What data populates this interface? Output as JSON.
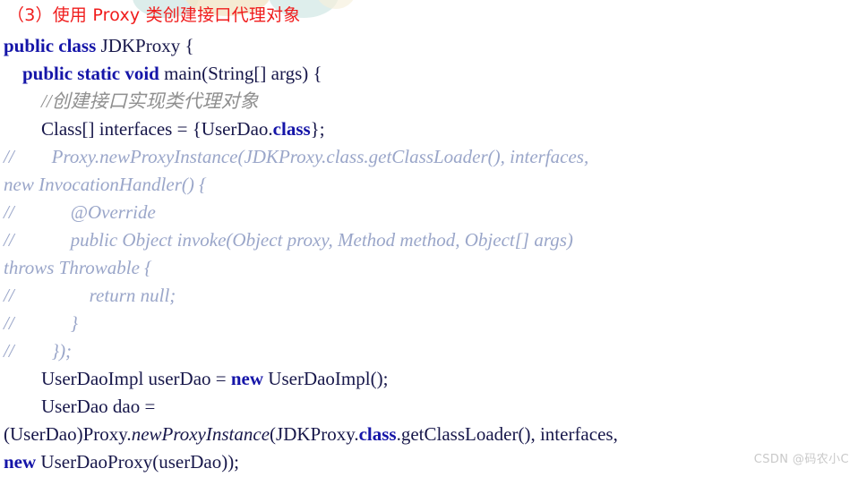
{
  "page": {
    "background_color": "#ffffff",
    "watermark": "CSDN @码农小C"
  },
  "decor": {
    "teal_color": "#cfe6e3",
    "cream_color": "#f3e6c8"
  },
  "title": {
    "text": "（3）使用 Proxy 类创建接口代理对象",
    "color": "#f01c1c"
  },
  "theme": {
    "keyword_color": "#1515a8",
    "plain_color": "#17174a",
    "comment_color": "#8f8f8f",
    "comment_block_color": "#9aa6c9"
  },
  "code": {
    "language": "java",
    "lines": [
      {
        "id": "l1",
        "text": "public class JDKProxy {"
      },
      {
        "id": "l2",
        "text": "    public static void main(String[] args) {"
      },
      {
        "id": "l3",
        "text": "        //创建接口实现类代理对象"
      },
      {
        "id": "l4",
        "text": "        Class[] interfaces = {UserDao.class};"
      },
      {
        "id": "l5",
        "text": "//        Proxy.newProxyInstance(JDKProxy.class.getClassLoader(), interfaces,"
      },
      {
        "id": "l6",
        "text": "new InvocationHandler() {"
      },
      {
        "id": "l7",
        "text": "//            @Override"
      },
      {
        "id": "l8",
        "text": "//            public Object invoke(Object proxy, Method method, Object[] args)"
      },
      {
        "id": "l9",
        "text": "throws Throwable {"
      },
      {
        "id": "l10",
        "text": "//                return null;"
      },
      {
        "id": "l11",
        "text": "//            }"
      },
      {
        "id": "l12",
        "text": "//        });"
      },
      {
        "id": "l13",
        "text": "        UserDaoImpl userDao = new UserDaoImpl();"
      },
      {
        "id": "l14",
        "text": "        UserDao dao ="
      },
      {
        "id": "l15",
        "text": "(UserDao)Proxy.newProxyInstance(JDKProxy.class.getClassLoader(), interfaces,"
      },
      {
        "id": "l16",
        "text": "new UserDaoProxy(userDao));"
      }
    ],
    "segments": [
      [
        {
          "t": "public class ",
          "c": "kw"
        },
        {
          "t": "JDKProxy {",
          "c": "plain"
        }
      ],
      [
        {
          "t": "    ",
          "c": "plain"
        },
        {
          "t": "public static void ",
          "c": "kw"
        },
        {
          "t": "main(String[] args) {",
          "c": "plain"
        }
      ],
      [
        {
          "t": "        //创建接口实现类代理对象",
          "c": "cmt"
        }
      ],
      [
        {
          "t": "        Class[] interfaces = {UserDao.",
          "c": "plain"
        },
        {
          "t": "class",
          "c": "kw"
        },
        {
          "t": "};",
          "c": "plain"
        }
      ],
      [
        {
          "t": "//        ",
          "c": "cmtblue"
        },
        {
          "t": "Proxy.newProxyInstance(JDKProxy.class.getClassLoader(), interfaces,",
          "c": "cmtblue"
        }
      ],
      [
        {
          "t": "new InvocationHandler() {",
          "c": "cmtblue"
        }
      ],
      [
        {
          "t": "//            @Override",
          "c": "cmtblue"
        }
      ],
      [
        {
          "t": "//            public Object invoke(Object proxy, Method method, Object[] args)",
          "c": "cmtblue"
        }
      ],
      [
        {
          "t": "throws Throwable {",
          "c": "cmtblue"
        }
      ],
      [
        {
          "t": "//                return null;",
          "c": "cmtblue"
        }
      ],
      [
        {
          "t": "//            }",
          "c": "cmtblue"
        }
      ],
      [
        {
          "t": "//        });",
          "c": "cmtblue"
        }
      ],
      [
        {
          "t": "        UserDaoImpl userDao = ",
          "c": "plain"
        },
        {
          "t": "new",
          "c": "kw"
        },
        {
          "t": " UserDaoImpl();",
          "c": "plain"
        }
      ],
      [
        {
          "t": "        UserDao dao =",
          "c": "plain"
        }
      ],
      [
        {
          "t": "(UserDao)Proxy.",
          "c": "plain"
        },
        {
          "t": "newProxyInstance",
          "c": "ital"
        },
        {
          "t": "(JDKProxy.",
          "c": "plain"
        },
        {
          "t": "class",
          "c": "kw"
        },
        {
          "t": ".getClassLoader(), interfaces,",
          "c": "plain"
        }
      ],
      [
        {
          "t": "new",
          "c": "kw"
        },
        {
          "t": " UserDaoProxy(userDao));",
          "c": "plain"
        }
      ]
    ]
  }
}
